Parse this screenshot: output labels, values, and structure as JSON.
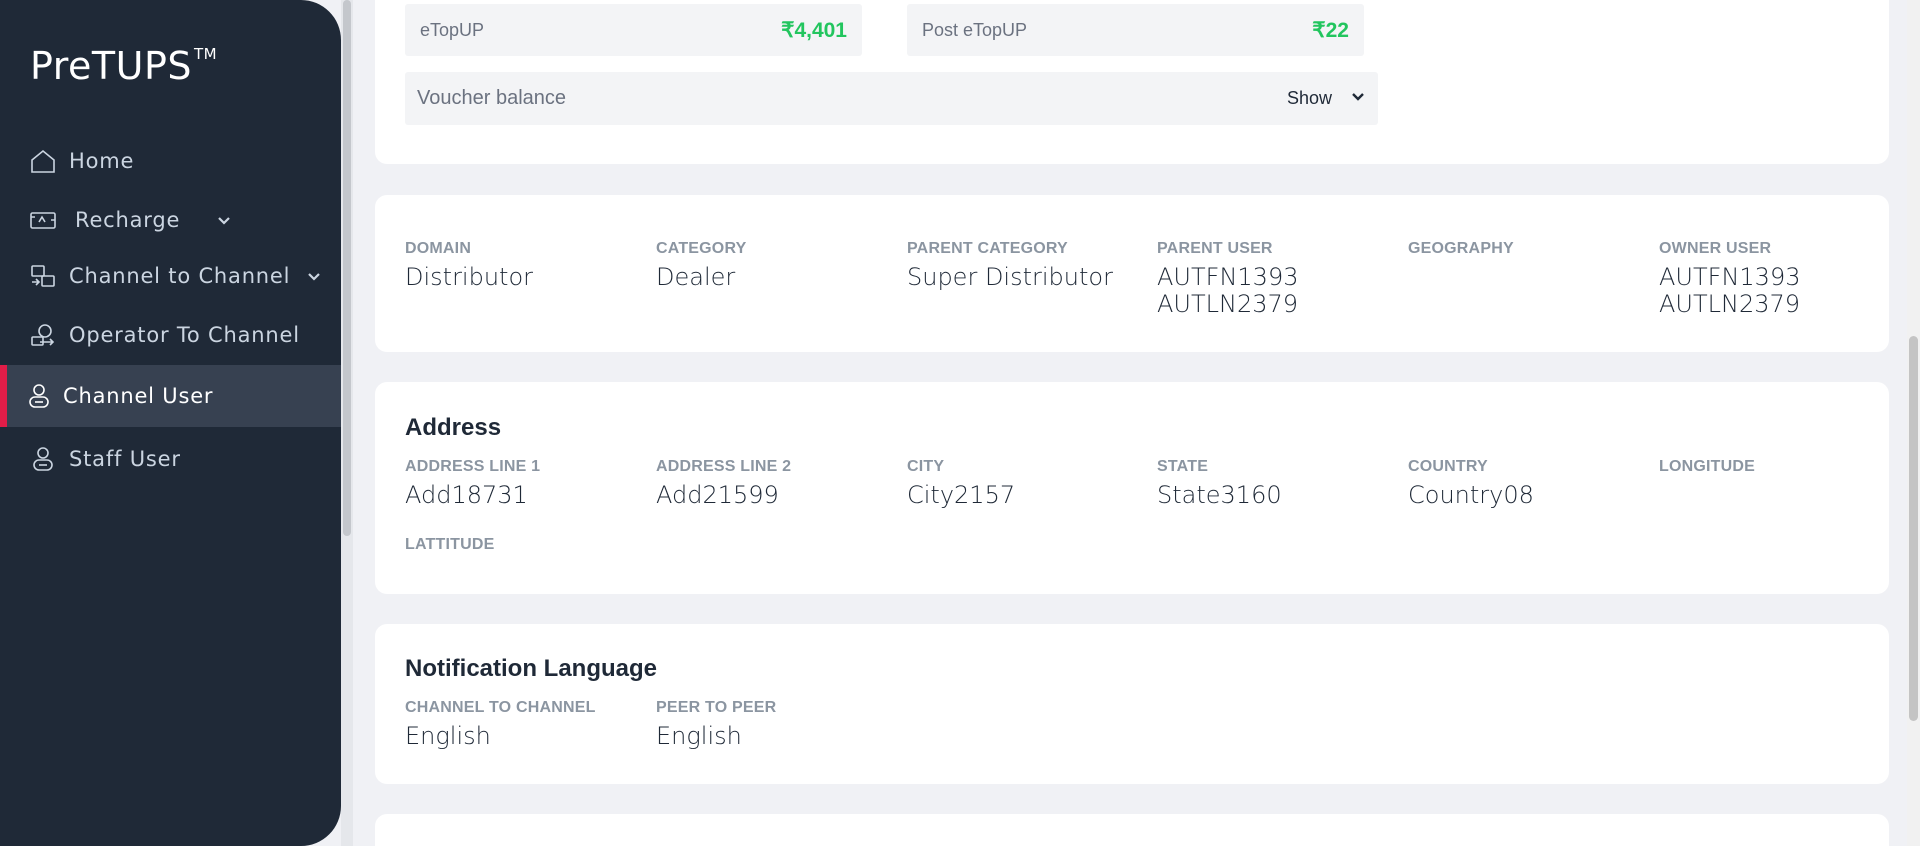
{
  "app": {
    "logo_text": "PreTUPS",
    "logo_tm": "TM"
  },
  "sidebar": {
    "items": [
      {
        "label": "Home",
        "icon": "home-icon"
      },
      {
        "label": "Recharge",
        "icon": "recharge-icon",
        "has_chevron": true
      },
      {
        "label": "Channel to Channel",
        "icon": "channel-transfer-icon",
        "has_chevron": true
      },
      {
        "label": "Operator To Channel",
        "icon": "operator-icon"
      },
      {
        "label": "Channel User",
        "icon": "user-icon",
        "active": true
      },
      {
        "label": "Staff User",
        "icon": "user-icon"
      }
    ]
  },
  "balances": {
    "etopup_label": "eTopUP",
    "etopup_value": "₹4,401",
    "post_etopup_label": "Post eTopUP",
    "post_etopup_value": "₹22",
    "voucher_label": "Voucher balance",
    "voucher_action": "Show"
  },
  "hierarchy": {
    "fields": [
      {
        "label": "DOMAIN",
        "value": "Distributor"
      },
      {
        "label": "CATEGORY",
        "value": "Dealer"
      },
      {
        "label": "PARENT CATEGORY",
        "value": "Super Distributor"
      },
      {
        "label": "PARENT USER",
        "value_line1": "AUTFN1393",
        "value_line2": "AUTLN2379"
      },
      {
        "label": "GEOGRAPHY",
        "value": ""
      },
      {
        "label": "OWNER USER",
        "value_line1": "AUTFN1393",
        "value_line2": "AUTLN2379"
      }
    ]
  },
  "address": {
    "title": "Address",
    "fields": [
      {
        "label": "ADDRESS LINE 1",
        "value": "Add18731"
      },
      {
        "label": "ADDRESS LINE 2",
        "value": "Add21599"
      },
      {
        "label": "CITY",
        "value": "City2157"
      },
      {
        "label": "STATE",
        "value": "State3160"
      },
      {
        "label": "COUNTRY",
        "value": "Country08"
      },
      {
        "label": "LONGITUDE",
        "value": ""
      },
      {
        "label": "LATTITUDE",
        "value": ""
      }
    ]
  },
  "notification_language": {
    "title": "Notification Language",
    "fields": [
      {
        "label": "CHANNEL TO CHANNEL",
        "value": "English"
      },
      {
        "label": "PEER TO PEER",
        "value": "English"
      }
    ]
  },
  "colors": {
    "sidebar_bg": "#1f2937",
    "active_accent": "#e11d48",
    "balance_green": "#22c55e"
  }
}
